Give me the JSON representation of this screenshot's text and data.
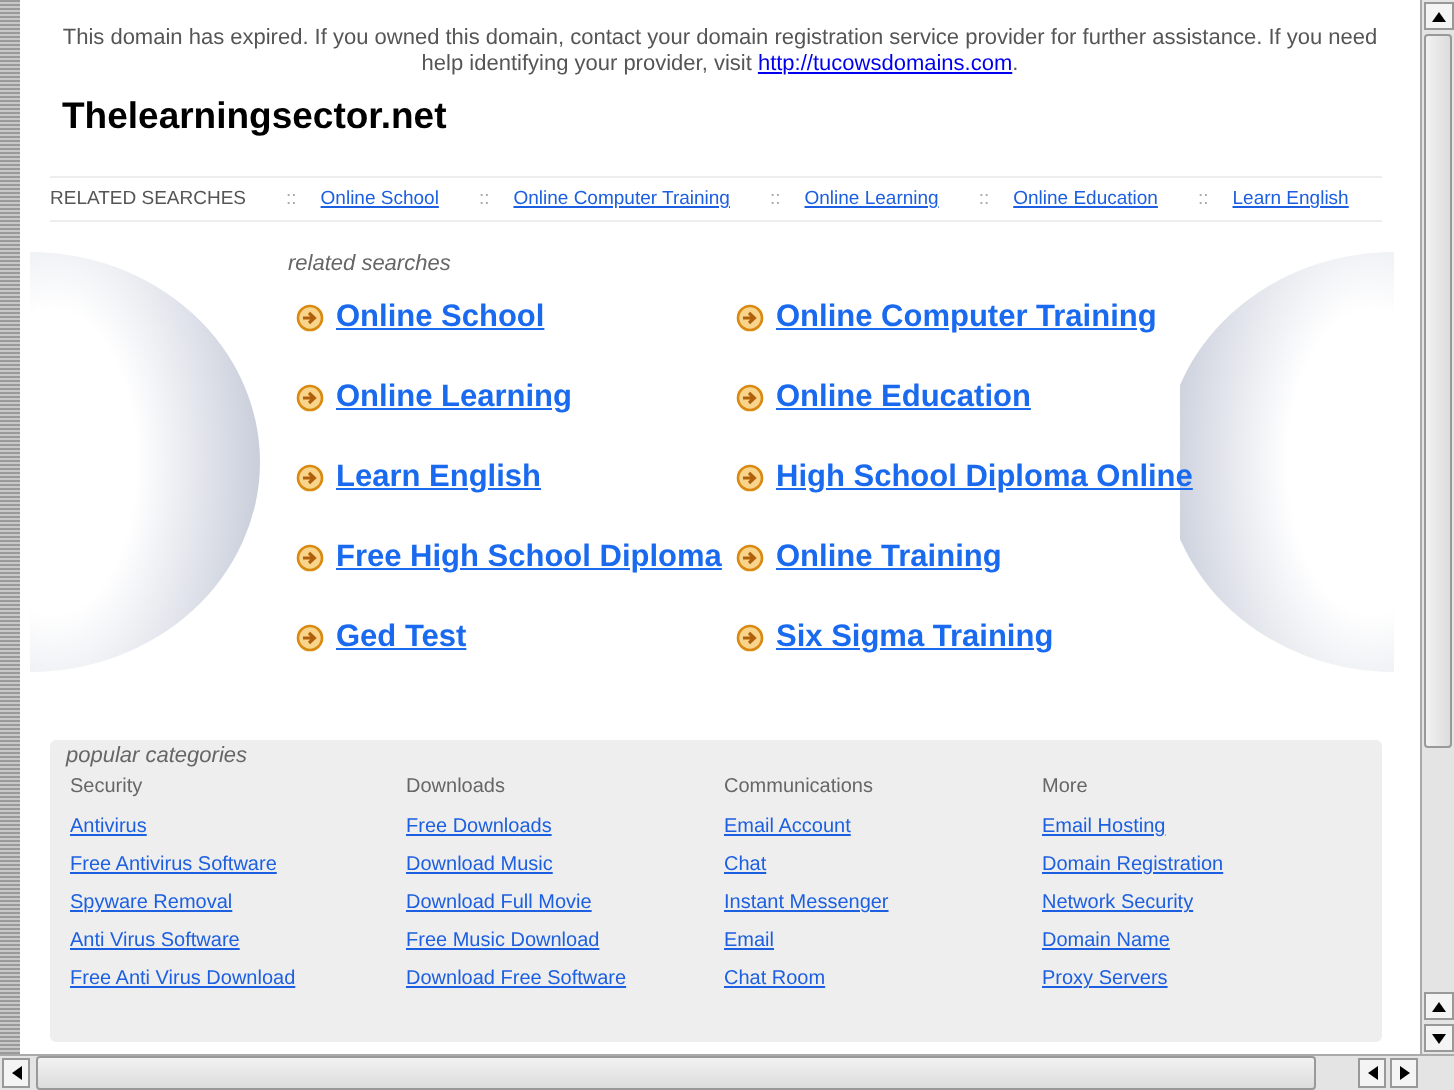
{
  "notice": {
    "text": "This domain has expired. If you owned this domain, contact your domain registration service provider for further assistance. If you need help identifying your provider, visit ",
    "link": "http://tucowsdomains.com",
    "end": "."
  },
  "site_title": "Thelearningsector.net",
  "related_bar": {
    "label": "RELATED SEARCHES",
    "separator": "::",
    "links": [
      "Online School",
      "Online Computer Training",
      "Online Learning",
      "Online Education",
      "Learn English"
    ]
  },
  "related_searches": {
    "title": "related searches",
    "links": [
      "Online School",
      "Online Computer Training",
      "Online Learning",
      "Online Education",
      "Learn English",
      "High School Diploma Online",
      "Free High School Diploma",
      "Online Training",
      "Ged Test",
      "Six Sigma Training"
    ]
  },
  "popular_categories": {
    "title": "popular categories",
    "columns": [
      {
        "heading": "Security",
        "links": [
          "Antivirus",
          "Free Antivirus Software",
          "Spyware Removal",
          "Anti Virus Software",
          "Free Anti Virus Download"
        ]
      },
      {
        "heading": "Downloads",
        "links": [
          "Free Downloads",
          "Download Music",
          "Download Full Movie",
          "Free Music Download",
          "Download Free Software"
        ]
      },
      {
        "heading": "Communications",
        "links": [
          "Email Account",
          "Chat",
          "Instant Messenger",
          "Email",
          "Chat Room"
        ]
      },
      {
        "heading": "More",
        "links": [
          "Email Hosting",
          "Domain Registration",
          "Network Security",
          "Domain Name",
          "Proxy Servers"
        ]
      }
    ]
  }
}
